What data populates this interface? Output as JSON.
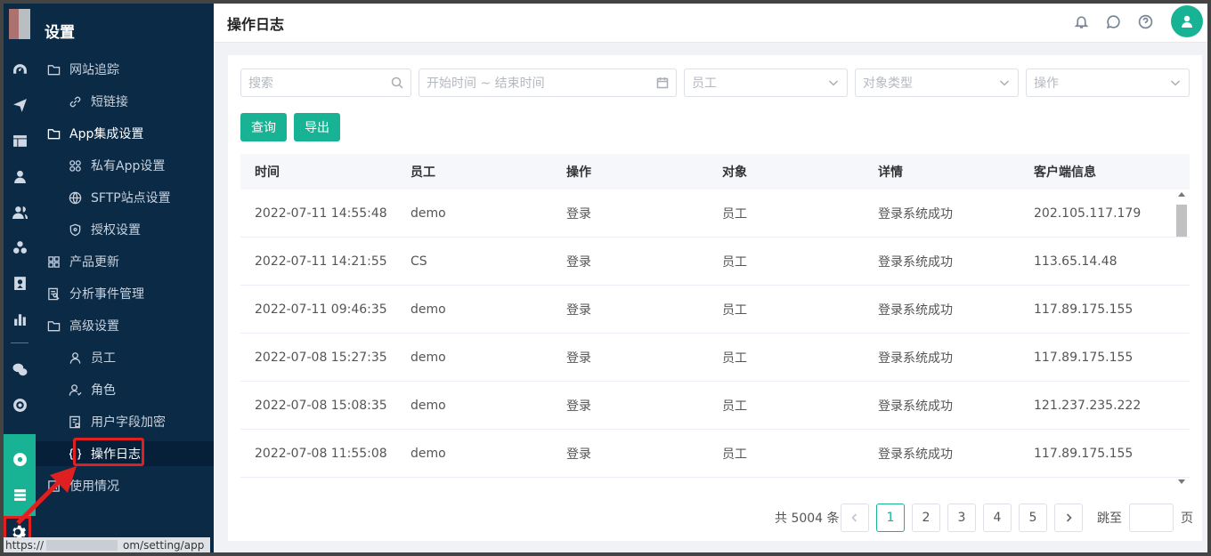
{
  "submenu": {
    "title": "设置",
    "items": [
      {
        "label": "网站追踪",
        "icon": "folder-icon"
      },
      {
        "label": "短链接",
        "icon": "link-icon"
      },
      {
        "label": "App集成设置",
        "icon": "folder-icon"
      },
      {
        "label": "私有App设置",
        "icon": "apps-icon"
      },
      {
        "label": "SFTP站点设置",
        "icon": "globe-icon"
      },
      {
        "label": "授权设置",
        "icon": "shield-icon"
      },
      {
        "label": "产品更新",
        "icon": "grid-icon"
      },
      {
        "label": "分析事件管理",
        "icon": "event-icon"
      },
      {
        "label": "高级设置",
        "icon": "folder-icon"
      },
      {
        "label": "员工",
        "icon": "user-icon"
      },
      {
        "label": "角色",
        "icon": "role-icon"
      },
      {
        "label": "用户字段加密",
        "icon": "encrypt-icon"
      },
      {
        "label": "操作日志",
        "icon": "braces-icon"
      },
      {
        "label": "使用情况",
        "icon": "usage-icon"
      }
    ],
    "active": "操作日志"
  },
  "statusbar": {
    "url_tail": "om/setting/app",
    "url_head": "https://"
  },
  "header": {
    "title": "操作日志"
  },
  "filters": {
    "search_placeholder": "搜索",
    "date_placeholder": "开始时间 ~ 结束时间",
    "employee_placeholder": "员工",
    "object_type_placeholder": "对象类型",
    "operation_placeholder": "操作"
  },
  "buttons": {
    "query": "查询",
    "export": "导出"
  },
  "table": {
    "columns": [
      "时间",
      "员工",
      "操作",
      "对象",
      "详情",
      "客户端信息"
    ],
    "rows": [
      [
        "2022-07-11 14:55:48",
        "demo",
        "登录",
        "员工",
        "登录系统成功",
        "202.105.117.179"
      ],
      [
        "2022-07-11 14:21:55",
        "CS",
        "登录",
        "员工",
        "登录系统成功",
        "113.65.14.48"
      ],
      [
        "2022-07-11 09:46:35",
        "demo",
        "登录",
        "员工",
        "登录系统成功",
        "117.89.175.155"
      ],
      [
        "2022-07-08 15:27:35",
        "demo",
        "登录",
        "员工",
        "登录系统成功",
        "117.89.175.155"
      ],
      [
        "2022-07-08 15:08:35",
        "demo",
        "登录",
        "员工",
        "登录系统成功",
        "121.237.235.222"
      ],
      [
        "2022-07-08 11:55:08",
        "demo",
        "登录",
        "员工",
        "登录系统成功",
        "117.89.175.155"
      ]
    ]
  },
  "pagination": {
    "total_text": "共 5004 条",
    "pages": [
      "1",
      "2",
      "3",
      "4",
      "5"
    ],
    "current": "1",
    "jump_label": "跳至",
    "page_unit": "页"
  },
  "colors": {
    "accent": "#18b394",
    "sidebar": "#0b2a46",
    "highlight": "#e02020"
  }
}
